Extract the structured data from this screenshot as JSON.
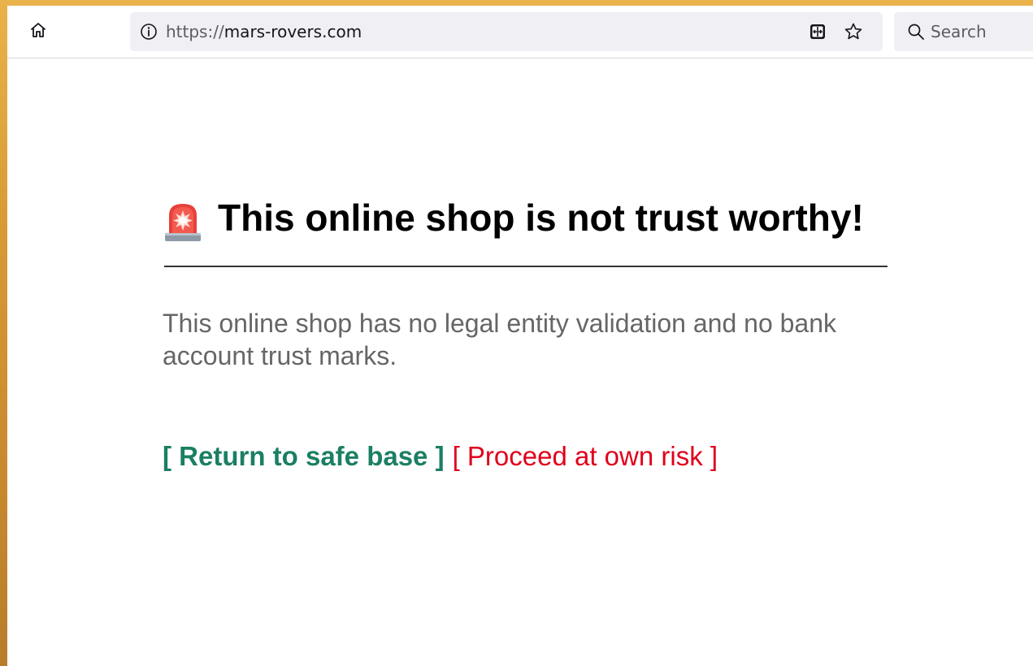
{
  "browser": {
    "url_scheme": "https://",
    "url_host": "mars-rovers.com",
    "search_placeholder": "Search",
    "icons": {
      "home": "home-icon",
      "info": "info-icon",
      "reader": "reader-view-icon",
      "bookmark": "star-icon",
      "search": "search-icon"
    }
  },
  "page": {
    "heading": "This online shop is not trust worthy!",
    "heading_icon": "siren-icon",
    "description": "This online shop has no legal entity validation and no bank account trust marks.",
    "actions": {
      "safe_label": "[ Return to safe base ]",
      "risk_label": "[ Proceed at own risk ]"
    }
  },
  "colors": {
    "safe_link": "#1b7f64",
    "risk_link": "#e0001b",
    "description_text": "#666666"
  }
}
